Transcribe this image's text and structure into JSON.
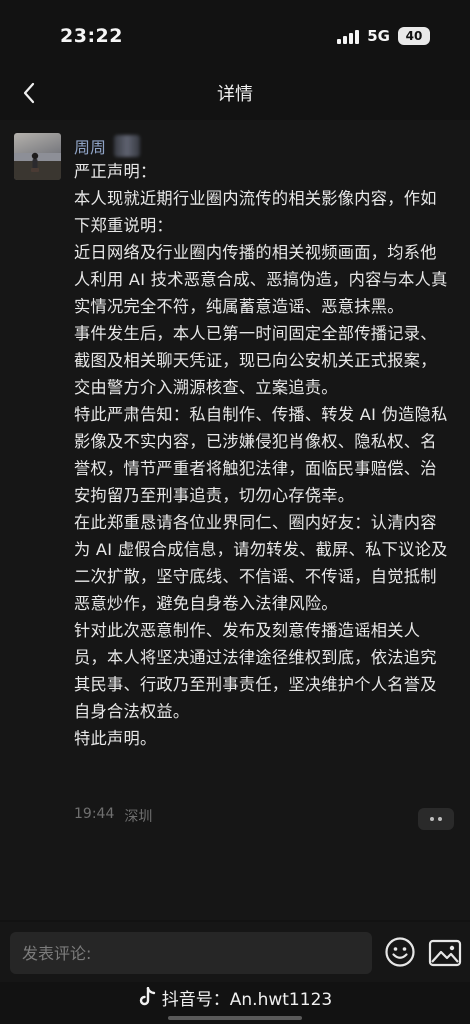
{
  "status_bar": {
    "time": "23:22",
    "network": "5G",
    "battery": "40"
  },
  "nav": {
    "title": "详情",
    "back_icon": "chevron-left-icon"
  },
  "post": {
    "author": "周周",
    "paragraphs": [
      "严正声明：",
      "本人现就近期行业圈内流传的相关影像内容，作如下郑重说明：",
      "近日网络及行业圈内传播的相关视频画面，均系他人利用 AI 技术恶意合成、恶搞伪造，内容与本人真实情况完全不符，纯属蓄意造谣、恶意抹黑。",
      "事件发生后，本人已第一时间固定全部传播记录、截图及相关聊天凭证，现已向公安机关正式报案，交由警方介入溯源核查、立案追责。",
      "特此严肃告知：私自制作、传播、转发 AI 伪造隐私影像及不实内容，已涉嫌侵犯肖像权、隐私权、名誉权，情节严重者将触犯法律，面临民事赔偿、治安拘留乃至刑事追责，切勿心存侥幸。",
      "在此郑重恳请各位业界同仁、圈内好友：认清内容为 AI 虚假合成信息，请勿转发、截屏、私下议论及二次扩散，坚守底线、不信谣、不传谣，自觉抵制恶意炒作，避免自身卷入法律风险。",
      "针对此次恶意制作、发布及刻意传播造谣相关人员，本人将坚决通过法律途径维权到底，依法追究其民事、行政乃至刑事责任，坚决维护个人名誉及自身合法权益。",
      "特此声明。"
    ],
    "time": "19:44",
    "location": "深圳"
  },
  "comment": {
    "placeholder": "发表评论:",
    "emoji_icon": "emoji-icon",
    "image_icon": "image-icon"
  },
  "watermark": {
    "text": "抖音号：An.hwt1123",
    "logo_icon": "douyin-logo-icon"
  }
}
